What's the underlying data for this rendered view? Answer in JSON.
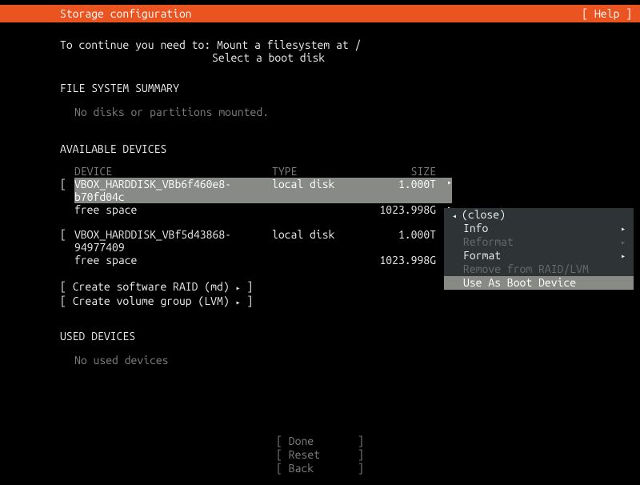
{
  "header": {
    "title": "Storage configuration",
    "help": "[ Help ]"
  },
  "continue": {
    "prefix": "To continue you need to:",
    "req1": "Mount a filesystem at /",
    "req2": "Select a boot disk"
  },
  "fs_summary": {
    "heading": "FILE SYSTEM SUMMARY",
    "empty": "No disks or partitions mounted."
  },
  "available": {
    "heading": "AVAILABLE DEVICES",
    "columns": {
      "device": "DEVICE",
      "type": "TYPE",
      "size": "SIZE"
    },
    "devices": [
      {
        "name": "VBOX_HARDDISK_VBb6f460e8-b70fd04c",
        "type": "local disk",
        "size": "1.000T",
        "free_label": "free space",
        "free_size": "1023.998G",
        "selected": true
      },
      {
        "name": "VBOX_HARDDISK_VBf5d43868-94977409",
        "type": "local disk",
        "size": "1.000T",
        "free_label": "free space",
        "free_size": "1023.998G",
        "selected": false
      }
    ],
    "actions": {
      "raid": "Create software RAID (md)",
      "lvm": "Create volume group (LVM)"
    }
  },
  "used": {
    "heading": "USED DEVICES",
    "empty": "No used devices"
  },
  "footer": {
    "done": "Done",
    "reset": "Reset",
    "back": "Back"
  },
  "context_menu": {
    "close": "(close)",
    "info": "Info",
    "reformat": "Reformat",
    "format": "Format",
    "remove": "Remove from RAID/LVM",
    "boot": "Use As Boot Device"
  },
  "glyph": {
    "right": "▸",
    "left": "◂"
  }
}
